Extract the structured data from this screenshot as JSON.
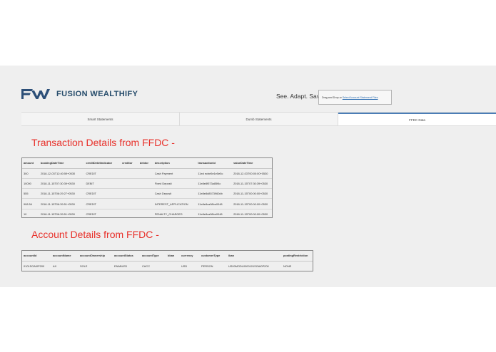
{
  "header": {
    "brand": "FUSION WEALTHIFY",
    "tagline": "See. Adapt. Save.",
    "drop_text": "Drag and Drop or",
    "drop_link": "Select Account Statement Files"
  },
  "tabs": [
    {
      "label": "Smart Statements"
    },
    {
      "label": "Dumb Statements"
    },
    {
      "label": "FFDC Data"
    }
  ],
  "transactions": {
    "title": "Transaction Details from FFDC -",
    "columns": [
      "amount",
      "bookingDateTime",
      "creditDebitIndicator",
      "creditor",
      "debtor",
      "description",
      "transactionId",
      "valueDateTime"
    ],
    "rows": [
      [
        "300",
        "2018-12-03T12:40:59+0530",
        "CREDIT",
        "",
        "",
        "Cash Payment",
        "11ed ecbe5e1e5e5c",
        "2018-12-03T00:00:00+0530"
      ],
      [
        "10000",
        "2018-11-15T07:30:39+0530",
        "DEBIT",
        "",
        "",
        "Fixed Deposit",
        "11e8e8f573a85f4c",
        "2018-11-15T07:30:39+0530"
      ],
      [
        "555",
        "2018-11-15T06:29:27+0530",
        "CREDIT",
        "",
        "",
        "Cash Deposit",
        "11e8e8d8573960db",
        "2018-11-15T00:00:00+0530"
      ],
      [
        "908.54",
        "2018-11-15T06:39:51+0530",
        "CREDIT",
        "",
        "",
        "INTEREST_APPLICATION",
        "11e8e8ca08be0048",
        "2018-11-15T00:00:00+0530"
      ],
      [
        "10",
        "2018-11-15T06:39:51+0530",
        "CREDIT",
        "",
        "",
        "PENALTY_CHARGES",
        "11e8e8ca08be0048",
        "2018-11-15T00:00:00+0530"
      ]
    ]
  },
  "accounts": {
    "title": "Account Details from FFDC -",
    "columns": [
      "accountId",
      "accountName",
      "accountOwnership",
      "accountStatus",
      "accountType",
      "bban",
      "currency",
      "customerType",
      "iban",
      "postingRestriction"
    ],
    "rows": [
      [
        "0101SGAI0P200",
        "AX",
        "SOLE",
        "ENABLED",
        "CACC",
        "",
        "USD",
        "PERSON",
        "US00MODL0000101SGAI0P200",
        "NONE"
      ]
    ]
  }
}
